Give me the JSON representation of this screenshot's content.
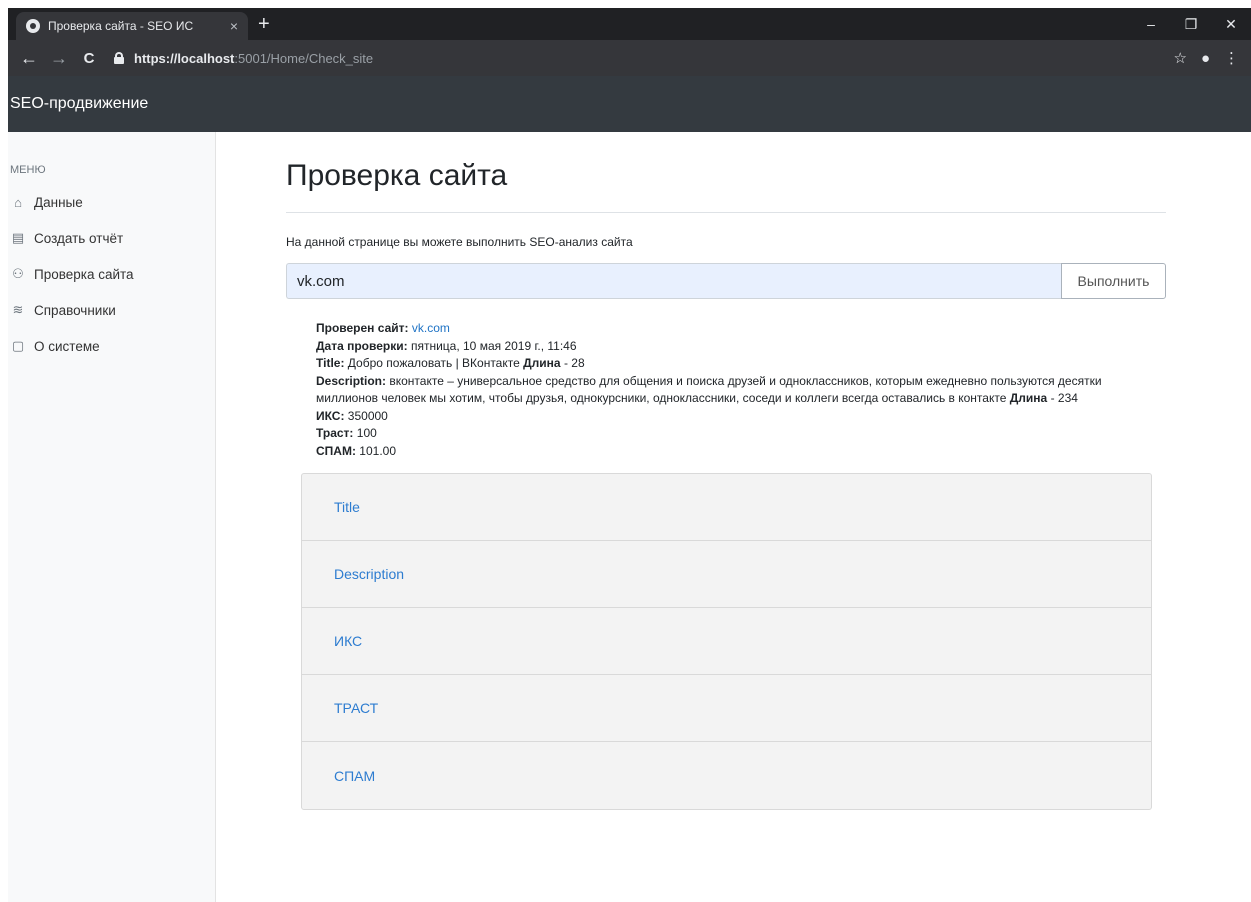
{
  "browser": {
    "tab_title": "Проверка сайта - SEO ИС",
    "tab_close": "×",
    "new_tab": "+",
    "url_protocol_host": "https://localhost",
    "url_rest": ":5001/Home/Check_site",
    "window_controls": {
      "minimize": "–",
      "maximize": "❐",
      "close": "✕"
    }
  },
  "nav": {
    "back": "←",
    "forward": "→",
    "reload": "C"
  },
  "toolbar_icons": {
    "star": "☆",
    "profile": "●",
    "menu": "⋮"
  },
  "app": {
    "brand": "SEO-продвижение"
  },
  "sidebar": {
    "heading": "МЕНЮ",
    "items": [
      {
        "label": "Данные",
        "icon": "home-icon",
        "glyph": "⌂"
      },
      {
        "label": "Создать отчёт",
        "icon": "file-text-icon",
        "glyph": "▤"
      },
      {
        "label": "Проверка сайта",
        "icon": "users-icon",
        "glyph": "⚇"
      },
      {
        "label": "Справочники",
        "icon": "layers-icon",
        "glyph": "≋"
      },
      {
        "label": "О системе",
        "icon": "file-icon",
        "glyph": "▢"
      }
    ]
  },
  "main": {
    "title": "Проверка сайта",
    "lead": "На данной странице вы можете выполнить SEO-анализ сайта",
    "search_value": "vk.com",
    "run_label": "Выполнить"
  },
  "results": {
    "checked_label": "Проверен сайт:",
    "checked_site": "vk.com",
    "date_label": "Дата проверки:",
    "date_value": "пятница, 10 мая 2019 г., 11:46",
    "title_label": "Title:",
    "title_value": "Добро пожаловать | ВКонтакте",
    "length_label": "Длина",
    "title_length": "- 28",
    "desc_label": "Description:",
    "desc_value": "вконтакте – универсальное средство для общения и поиска друзей и одноклассников, которым ежедневно пользуются десятки миллионов человек мы хотим, чтобы друзья, однокурсники, одноклассники, соседи и коллеги всегда оставались в контакте",
    "desc_length": "- 234",
    "iks_label": "ИКС:",
    "iks_value": "350000",
    "trust_label": "Траст:",
    "trust_value": "100",
    "spam_label": "СПАМ:",
    "spam_value": "101.00"
  },
  "accordion": [
    "Title",
    "Description",
    "ИКС",
    "ТРАСТ",
    "СПАМ"
  ]
}
